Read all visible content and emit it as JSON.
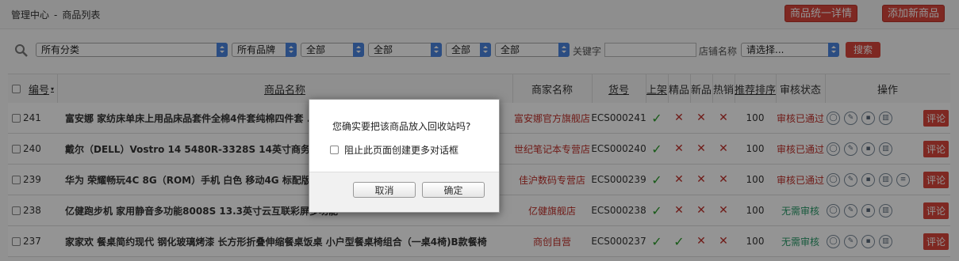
{
  "header": {
    "breadcrumb_home": "管理中心",
    "breadcrumb_sep": "-",
    "breadcrumb_current": "商品列表",
    "btn_unified_detail": "商品统一详情",
    "btn_add_product": "添加新商品"
  },
  "filters": {
    "category": "所有分类",
    "brand": "所有品牌",
    "sel3": "全部",
    "sel4": "全部",
    "sel5": "全部",
    "sel6": "全部",
    "keyword_label": "关键字",
    "keyword_value": "",
    "shop_label": "店铺名称",
    "shop_select": "请选择...",
    "search_button": "搜索"
  },
  "table": {
    "headers": {
      "id": "编号",
      "name": "商品名称",
      "shop": "商家名称",
      "sku": "货号",
      "on_sale": "上架",
      "best": "精品",
      "new": "新品",
      "hot": "热销",
      "sort": "推荐排序",
      "review": "审核状态",
      "ops": "操作"
    },
    "rows": [
      {
        "id": "241",
        "name": "富安娜 家纺床单床上用品床品套件全棉4件套纯棉四件套 ...",
        "shop": "富安娜官方旗舰店",
        "sku": "ECS000241",
        "on_sale": "✓",
        "best": "✕",
        "new": "✕",
        "hot": "✕",
        "sort": "100",
        "review": "审核已通过",
        "comment": "评论"
      },
      {
        "id": "240",
        "name": "戴尔（DELL）Vostro 14 5480R-3328S 14英寸商务超薄...",
        "shop": "世纪笔记本专营店",
        "sku": "ECS000240",
        "on_sale": "✓",
        "best": "✕",
        "new": "✕",
        "hot": "✕",
        "sort": "100",
        "review": "审核已通过",
        "comment": "评论"
      },
      {
        "id": "239",
        "name": "华为 荣耀畅玩4C 8G（ROM）手机 白色 移动4G 标配版",
        "shop": "佳沪数码专营店",
        "sku": "ECS000239",
        "on_sale": "✓",
        "best": "✕",
        "new": "✕",
        "hot": "✕",
        "sort": "100",
        "review": "审核已通过",
        "comment": "评论"
      },
      {
        "id": "238",
        "name": "亿健跑步机 家用静音多功能8008S 13.3英寸云互联彩屏多功能",
        "shop": "亿健旗舰店",
        "sku": "ECS000238",
        "on_sale": "✓",
        "best": "✕",
        "new": "✕",
        "hot": "✕",
        "sort": "100",
        "review": "无需审核",
        "comment": "评论"
      },
      {
        "id": "237",
        "name": "家家欢 餐桌简约现代 钢化玻璃烤漆 长方形折叠伸缩餐桌饭桌 小户型餐桌椅组合（一桌4椅)B款餐椅",
        "shop": "商创自营",
        "sku": "ECS000237",
        "on_sale": "✓",
        "best": "✓",
        "new": "✕",
        "hot": "✕",
        "sort": "100",
        "review": "无需审核",
        "comment": "评论"
      }
    ]
  },
  "dialog": {
    "message": "您确实要把该商品放入回收站吗?",
    "checkbox_label": "阻止此页面创建更多对话框",
    "cancel": "取消",
    "ok": "确定"
  }
}
